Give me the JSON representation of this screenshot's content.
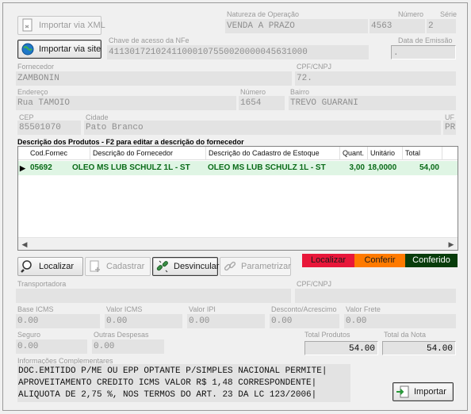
{
  "buttons": {
    "importar_xml": "Importar via XML",
    "importar_site": "Importar via site",
    "localizar": "Localizar",
    "cadastrar": "Cadastrar",
    "desvincular": "Desvincular",
    "parametrizar": "Parametrizar",
    "importar": "Importar"
  },
  "header": {
    "natureza_label": "Natureza de Operação",
    "natureza_value": "VENDA A PRAZO",
    "numero_label": "Número",
    "numero_value": "4563",
    "serie_label": "Série",
    "serie_value": "2",
    "chave_label": "Chave de acesso da NFe",
    "chave_value": "41130172102411000107550020000045631000",
    "emissao_label": "Data de Emissão",
    "emissao_value": "."
  },
  "fornecedor": {
    "fornecedor_label": "Fornecedor",
    "fornecedor_value": "ZAMBONIN",
    "cpf_label": "CPF/CNPJ",
    "cpf_value": "72.",
    "endereco_label": "Endereço",
    "endereco_value": "Rua TAMOIO",
    "numero_label": "Número",
    "numero_value": "1654",
    "bairro_label": "Bairro",
    "bairro_value": "TREVO GUARANI",
    "cep_label": "CEP",
    "cep_value": "85501070",
    "cidade_label": "Cidade",
    "cidade_value": "Pato Branco",
    "uf_label": "UF",
    "uf_value": "PR"
  },
  "produtos": {
    "title": "Descrição dos Produtos - F2 para editar a descrição do fornecedor",
    "columns": [
      "Cod.Fornec",
      "Descrição do Fornecedor",
      "Descrição do Cadastro de Estoque",
      "Quant.",
      "Unitário",
      "Total"
    ],
    "rows": [
      [
        "05692",
        "OLEO MS LUB SCHULZ 1L - ST",
        "OLEO MS LUB SCHULZ 1L - ST",
        "3,00",
        "18,0000",
        "54,00"
      ]
    ],
    "row_indicator": "▶",
    "scroll_left": "◀",
    "scroll_right": "▶"
  },
  "legend": {
    "localizar": "Localizar",
    "conferir": "Conferir",
    "conferido": "Conferido",
    "colors": {
      "localizar": "#e8173a",
      "conferir": "#ff7a00",
      "conferido": "#083c0b"
    }
  },
  "transporte": {
    "transportadora_label": "Transportadora",
    "transportadora_value": "",
    "cpf_label": "CPF/CNPJ",
    "cpf_value": ""
  },
  "totais": {
    "base_icms_label": "Base ICMS",
    "base_icms_value": "0.00",
    "valor_icms_label": "Valor ICMS",
    "valor_icms_value": "0.00",
    "valor_ipi_label": "Valor IPI",
    "valor_ipi_value": "0.00",
    "desconto_label": "Desconto/Acrescimo",
    "desconto_value": "0.00",
    "frete_label": "Valor Frete",
    "frete_value": "0.00",
    "seguro_label": "Seguro",
    "seguro_value": "0.00",
    "outras_label": "Outras Despesas",
    "outras_value": "0.00",
    "total_produtos_label": "Total Produtos",
    "total_produtos_value": "54.00",
    "total_nota_label": "Total da Nota",
    "total_nota_value": "54.00"
  },
  "info": {
    "label": "Informações Complementares",
    "text": "DOC.EMITIDO P/ME OU EPP OPTANTE P/SIMPLES NACIONAL PERMITE|\nAPROVEITAMENTO CREDITO ICMS VALOR R$ 1,48 CORRESPONDENTE|\nALIQUOTA DE 2,75 %, NOS TERMOS DO ART. 23 DA LC 123/2006|"
  },
  "icons": {
    "xml": "xml-file-icon",
    "site": "globe-icon",
    "localizar": "magnifier-icon",
    "cadastrar": "add-document-icon",
    "desvincular": "unlink-icon",
    "parametrizar": "link-icon",
    "importar": "import-arrow-icon"
  }
}
